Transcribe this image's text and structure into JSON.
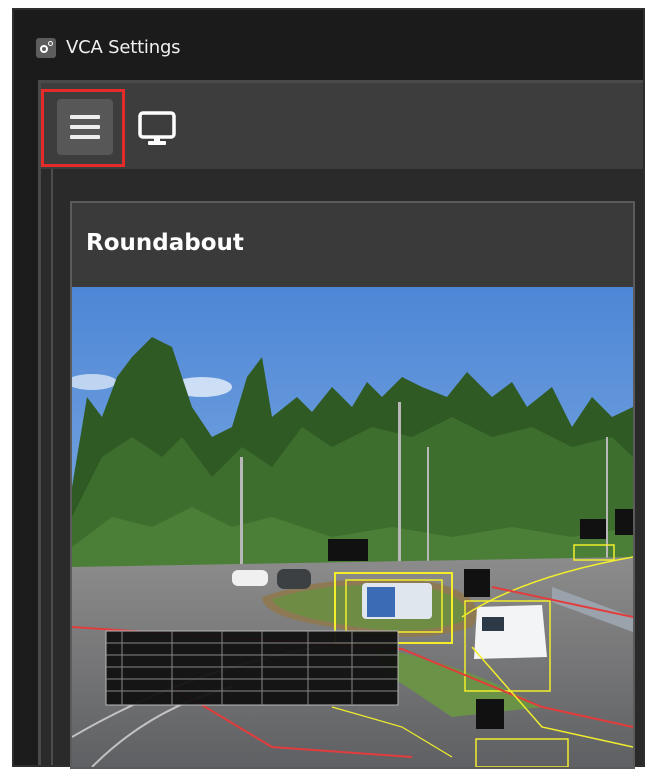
{
  "window": {
    "title": "VCA Settings",
    "icon": "settings-app-icon"
  },
  "toolbar": {
    "menu_icon": "hamburger-menu-icon",
    "monitor_icon": "monitor-icon",
    "highlight_color": "#e52a2a"
  },
  "panel": {
    "title": "Roundabout",
    "video": "camera feed of roundabout with vehicle detection overlays"
  },
  "colors": {
    "window_bg": "#1c1c1c",
    "toolbar_bg": "#3d3d3d",
    "panel_header_bg": "#3a3a3a",
    "detection_box": "#f2ee2c",
    "zone_line": "#e23c3c"
  }
}
